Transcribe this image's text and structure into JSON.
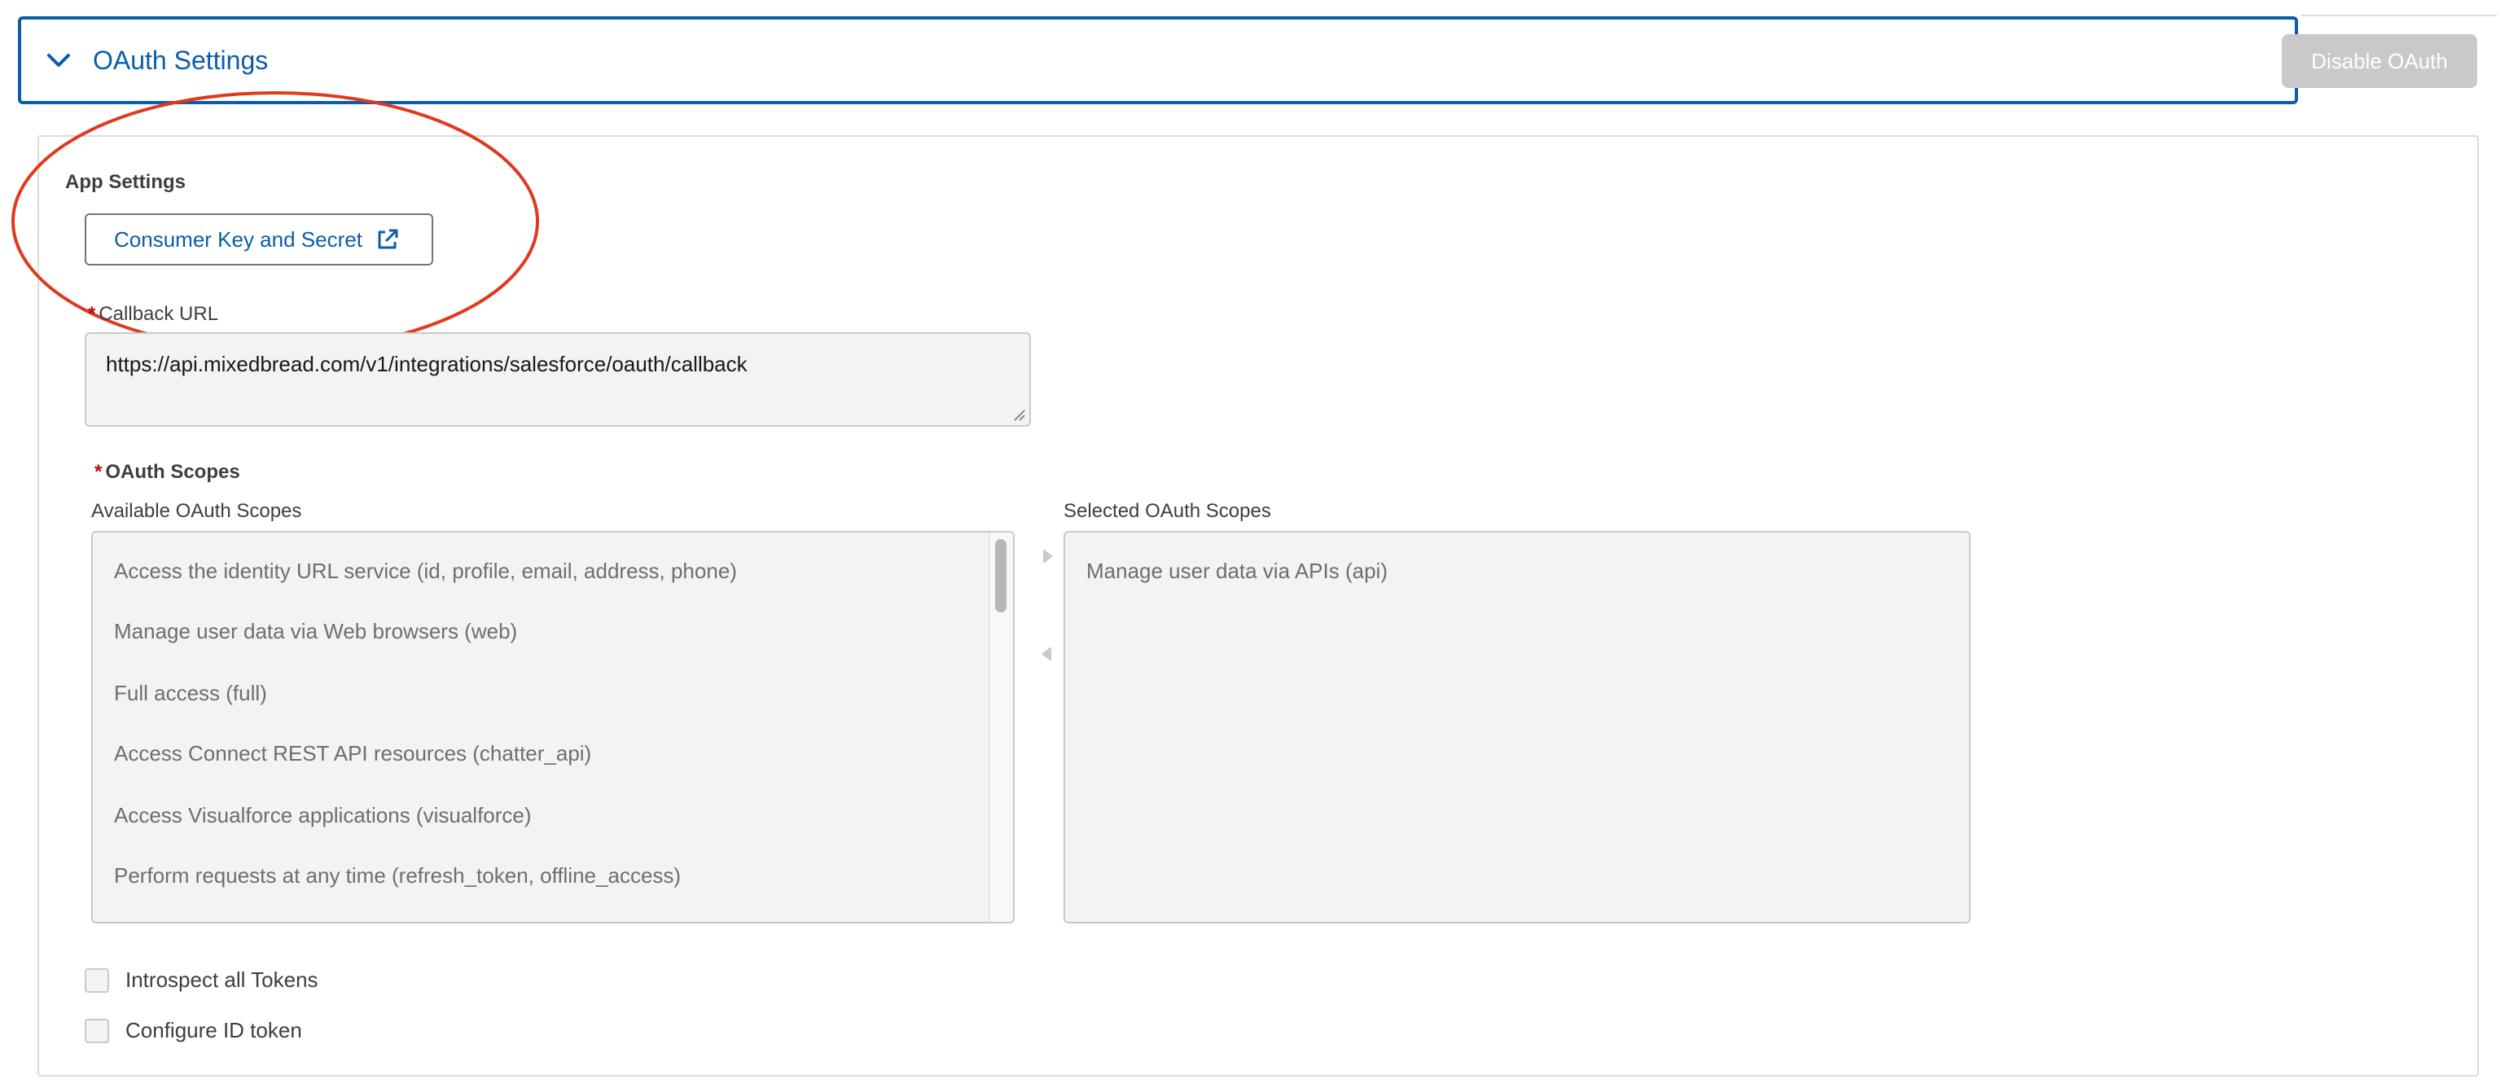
{
  "header": {
    "section_title": "OAuth Settings",
    "disable_button": "Disable OAuth"
  },
  "app_settings": {
    "title": "App Settings",
    "consumer_button": "Consumer Key and Secret"
  },
  "callback": {
    "required_marker": "*",
    "label": "Callback URL",
    "value": "https://api.mixedbread.com/v1/integrations/salesforce/oauth/callback"
  },
  "scopes": {
    "required_marker": "*",
    "title": "OAuth Scopes",
    "available_label": "Available OAuth Scopes",
    "selected_label": "Selected OAuth Scopes",
    "available_items": [
      "Access the identity URL service (id, profile, email, address, phone)",
      "Manage user data via Web browsers (web)",
      "Full access (full)",
      "Access Connect REST API resources (chatter_api)",
      "Access Visualforce applications (visualforce)",
      "Perform requests at any time (refresh_token, offline_access)"
    ],
    "selected_items": [
      "Manage user data via APIs (api)"
    ]
  },
  "options": {
    "introspect_label": "Introspect all Tokens",
    "introspect_checked": false,
    "id_token_label": "Configure ID token",
    "id_token_checked": false
  },
  "colors": {
    "accent": "#0b5cab",
    "annotation": "#e03a1e",
    "required": "#ba0517",
    "disabled_button": "#c9c9c9"
  },
  "icons": {
    "chevron": "chevron-down-icon",
    "external_link": "external-link-icon",
    "move_right": "arrow-right-icon",
    "move_left": "arrow-left-icon"
  }
}
